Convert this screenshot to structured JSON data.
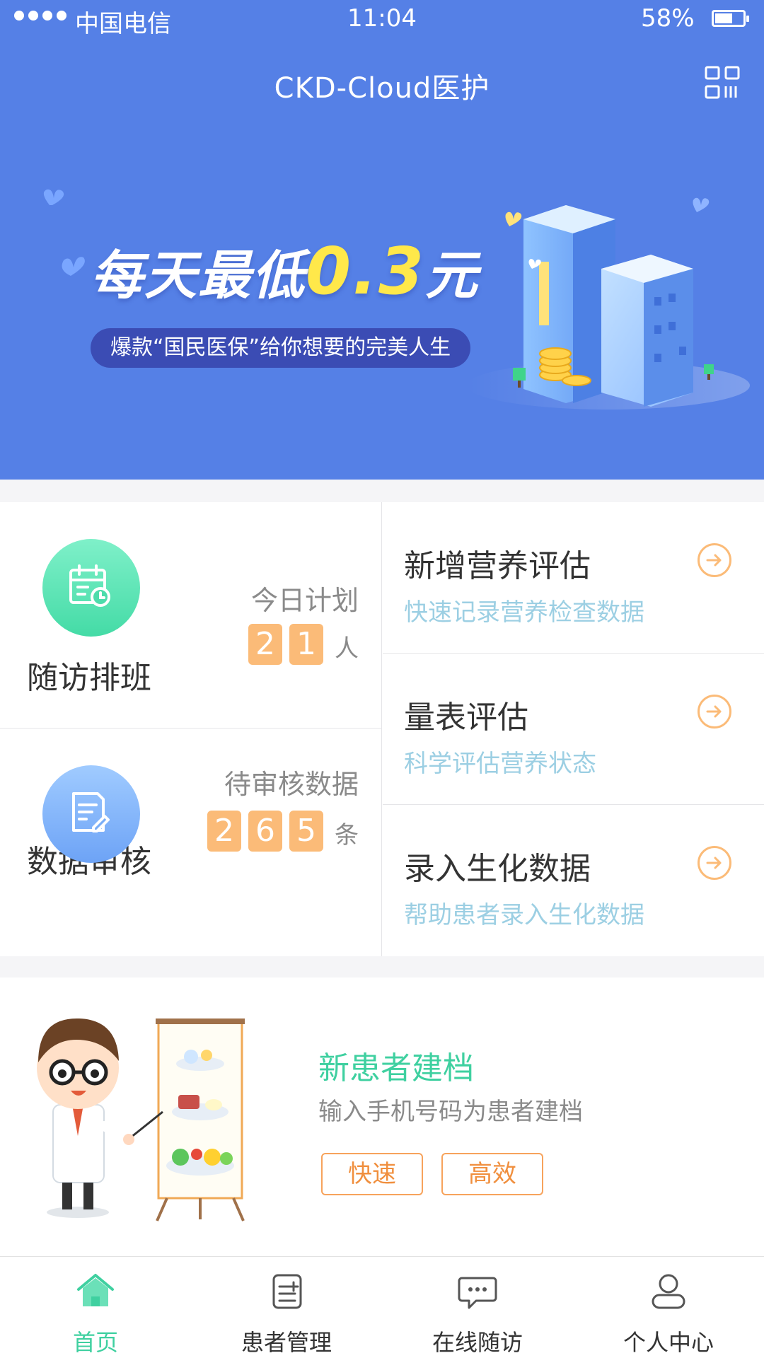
{
  "status_bar": {
    "carrier": "中国电信",
    "time": "11:04",
    "battery": "58%"
  },
  "header": {
    "title": "CKD-Cloud医护",
    "qr_icon": "qr-scan-icon"
  },
  "banner": {
    "title_prefix": "每天最低",
    "title_highlight": "0.3",
    "title_suffix": "元",
    "subtitle": "爆款“国民医保”给你想要的完美人生"
  },
  "stats": {
    "schedule": {
      "name": "随访排班",
      "label": "今日计划",
      "digits": [
        "2",
        "1"
      ],
      "unit": "人",
      "icon": "calendar-clock-icon"
    },
    "review": {
      "name": "数据审核",
      "label": "待审核数据",
      "digits": [
        "2",
        "6",
        "5"
      ],
      "unit": "条",
      "icon": "document-edit-icon"
    }
  },
  "actions": [
    {
      "title": "新增营养评估",
      "subtitle": "快速记录营养检查数据"
    },
    {
      "title": "量表评估",
      "subtitle": "科学评估营养状态"
    },
    {
      "title": "录入生化数据",
      "subtitle": "帮助患者录入生化数据"
    }
  ],
  "new_patient": {
    "title": "新患者建档",
    "subtitle": "输入手机号码为患者建档",
    "tags": [
      "快速",
      "高效"
    ]
  },
  "tabs": [
    {
      "label": "首页",
      "icon": "home-icon",
      "active": true
    },
    {
      "label": "患者管理",
      "icon": "patient-list-icon",
      "active": false
    },
    {
      "label": "在线随访",
      "icon": "chat-bubble-icon",
      "active": false
    },
    {
      "label": "个人中心",
      "icon": "user-icon",
      "active": false
    }
  ],
  "colors": {
    "header_bg": "#5580e6",
    "accent_green": "#3fd0a0",
    "accent_orange": "#fbbb78",
    "subtitle_blue": "#9ccfe3"
  }
}
